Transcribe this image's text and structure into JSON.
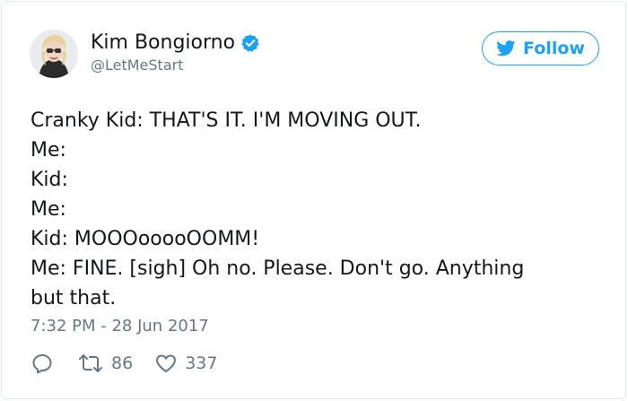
{
  "tweet": {
    "author": {
      "display_name": "Kim Bongiorno",
      "handle": "@LetMeStart",
      "verified": true
    },
    "follow_button": {
      "label": "Follow",
      "icon": "twitter-bird-icon"
    },
    "text_lines": [
      "Cranky Kid: THAT'S IT. I'M MOVING OUT.",
      "Me:",
      "Kid:",
      "Me:",
      "Kid: MOOOooooOOMM!",
      "Me: FINE. [sigh] Oh no. Please. Don't go. Anything",
      "but that."
    ],
    "timestamp": "7:32 PM - 28 Jun 2017",
    "actions": {
      "reply": {
        "icon": "reply-icon",
        "count": ""
      },
      "retweet": {
        "icon": "retweet-icon",
        "count": "86"
      },
      "like": {
        "icon": "heart-icon",
        "count": "337"
      }
    }
  },
  "colors": {
    "accent": "#1da1f2",
    "text": "#14171a",
    "muted": "#657786",
    "border": "#e1e8ed"
  }
}
